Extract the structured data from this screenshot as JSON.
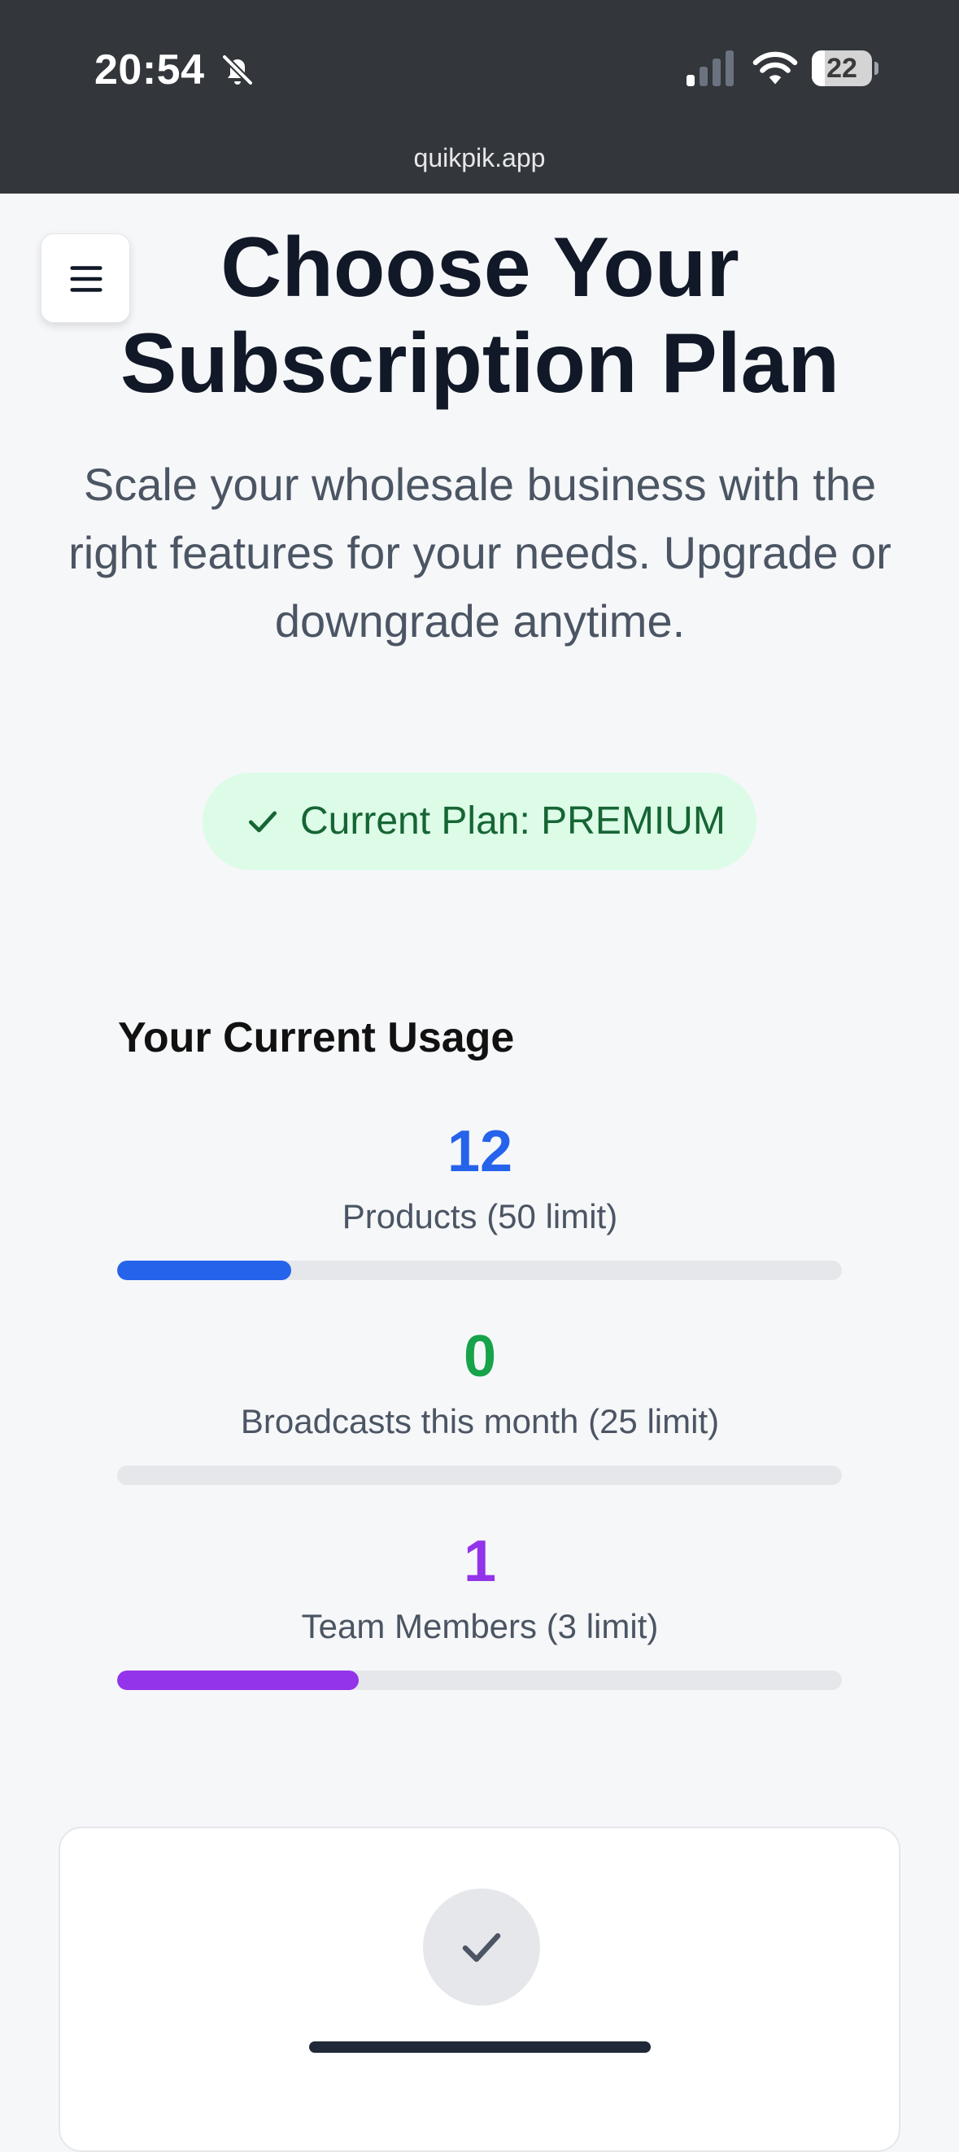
{
  "status_bar": {
    "time": "20:54",
    "battery_level": "22",
    "battery_fraction": 0.22,
    "url": "quikpik.app"
  },
  "icons": {
    "silent": "bell-slash-icon",
    "signal": "cellular-signal-icon",
    "wifi": "wifi-icon",
    "battery": "battery-icon",
    "menu": "hamburger-menu-icon",
    "check": "checkmark-icon"
  },
  "header": {
    "title": "Choose Your Subscription Plan",
    "subtitle": "Scale your wholesale business with the right features for your needs. Upgrade or downgrade anytime."
  },
  "current_plan": {
    "label": "Current Plan: PREMIUM"
  },
  "usage": {
    "title": "Your Current Usage",
    "items": [
      {
        "value": "12",
        "label": "Products (50 limit)",
        "fraction": 0.24,
        "color": "#2563eb"
      },
      {
        "value": "0",
        "label": "Broadcasts this month (25 limit)",
        "fraction": 0,
        "color": "#16a34a"
      },
      {
        "value": "1",
        "label": "Team Members (3 limit)",
        "fraction": 0.3333,
        "color": "#9333ea"
      }
    ]
  },
  "colors": {
    "status_bar_bg": "#33363a",
    "page_bg": "#f6f7f9",
    "pill_bg": "#dcfce7",
    "pill_text": "#166534",
    "track": "#e5e7eb"
  }
}
